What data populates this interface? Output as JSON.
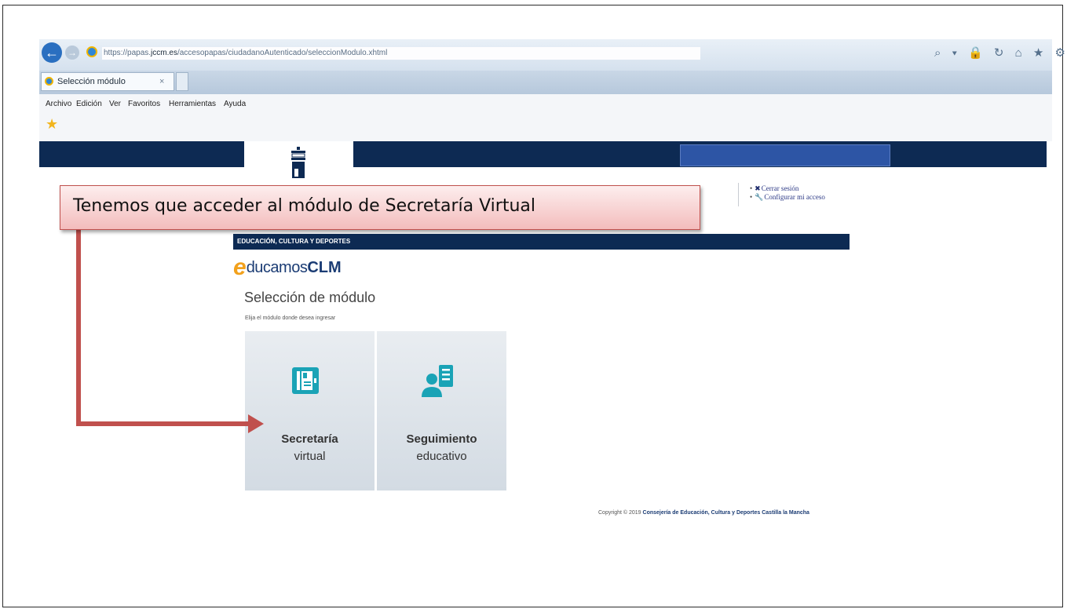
{
  "browser": {
    "url_prefix": "https://papas.",
    "url_domain": "jccm.es",
    "url_path": "/accesopapas/ciudadanoAutenticado/seleccionModulo.xhtml",
    "tab_title": "Selección módulo",
    "tab_close": "×",
    "menu": [
      "Archivo",
      "Edición",
      "Ver",
      "Favoritos",
      "Herramientas",
      "Ayuda"
    ],
    "nav_icons": "⌕ ▾ 🔒 ↻ ⌂ ★ ⚙"
  },
  "user_menu": {
    "logout": "Cerrar sesión",
    "configure": "Configurar mi acceso"
  },
  "callout": {
    "text": "Tenemos que acceder al módulo de Secretaría Virtual"
  },
  "header": {
    "department": "EDUCACIÓN, CULTURA Y DEPORTES",
    "brand_e": "e",
    "brand_mid": "ducamos",
    "brand_clm": "CLM"
  },
  "main": {
    "title": "Selección de módulo",
    "subtitle": "Elija el módulo donde desea ingresar",
    "modules": [
      {
        "line1": "Secretaría",
        "line2": "virtual",
        "icon": "book-icon"
      },
      {
        "line1": "Seguimiento",
        "line2": "educativo",
        "icon": "person-document-icon"
      }
    ]
  },
  "footer": {
    "copyright_prefix": "Copyright © 2019",
    "copyright_org": "Consejería de Educación, Cultura y Deportes Castilla la Mancha"
  },
  "colors": {
    "navy": "#0d2a53",
    "teal": "#1aa3b6",
    "callout_border": "#c0504d",
    "brand_orange": "#f2a11c"
  }
}
